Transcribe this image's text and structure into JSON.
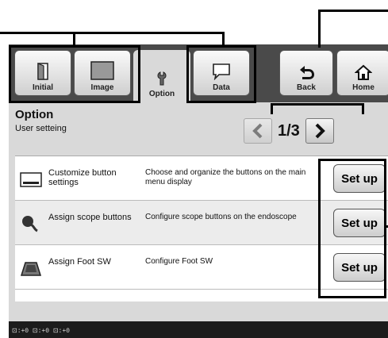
{
  "tabs": {
    "initial": "Initial",
    "image": "Image",
    "option": "Option",
    "data": "Data",
    "back": "Back",
    "home": "Home"
  },
  "page": {
    "title": "Option",
    "subtitle": "User setteing"
  },
  "pager": {
    "text": "1/3",
    "current": 1,
    "total": 3
  },
  "rows": [
    {
      "name": "Customize button settings",
      "desc": "Choose and organize the buttons on the main menu display",
      "button": "Set up",
      "icon": "keyboard-icon"
    },
    {
      "name": "Assign scope buttons",
      "desc": "Configure scope buttons on the endoscope",
      "button": "Set up",
      "icon": "scope-icon"
    },
    {
      "name": "Assign Foot SW",
      "desc": "Configure Foot SW",
      "button": "Set up",
      "icon": "foot-switch-icon"
    }
  ],
  "status": {
    "text": "⊡:+0 ⊡:+0 ⊡:+0"
  },
  "colors": {
    "topbar": "#4a4a4a",
    "screen": "#d9d9d9",
    "statusbar": "#1c1c1c",
    "highlight": "#000000"
  }
}
